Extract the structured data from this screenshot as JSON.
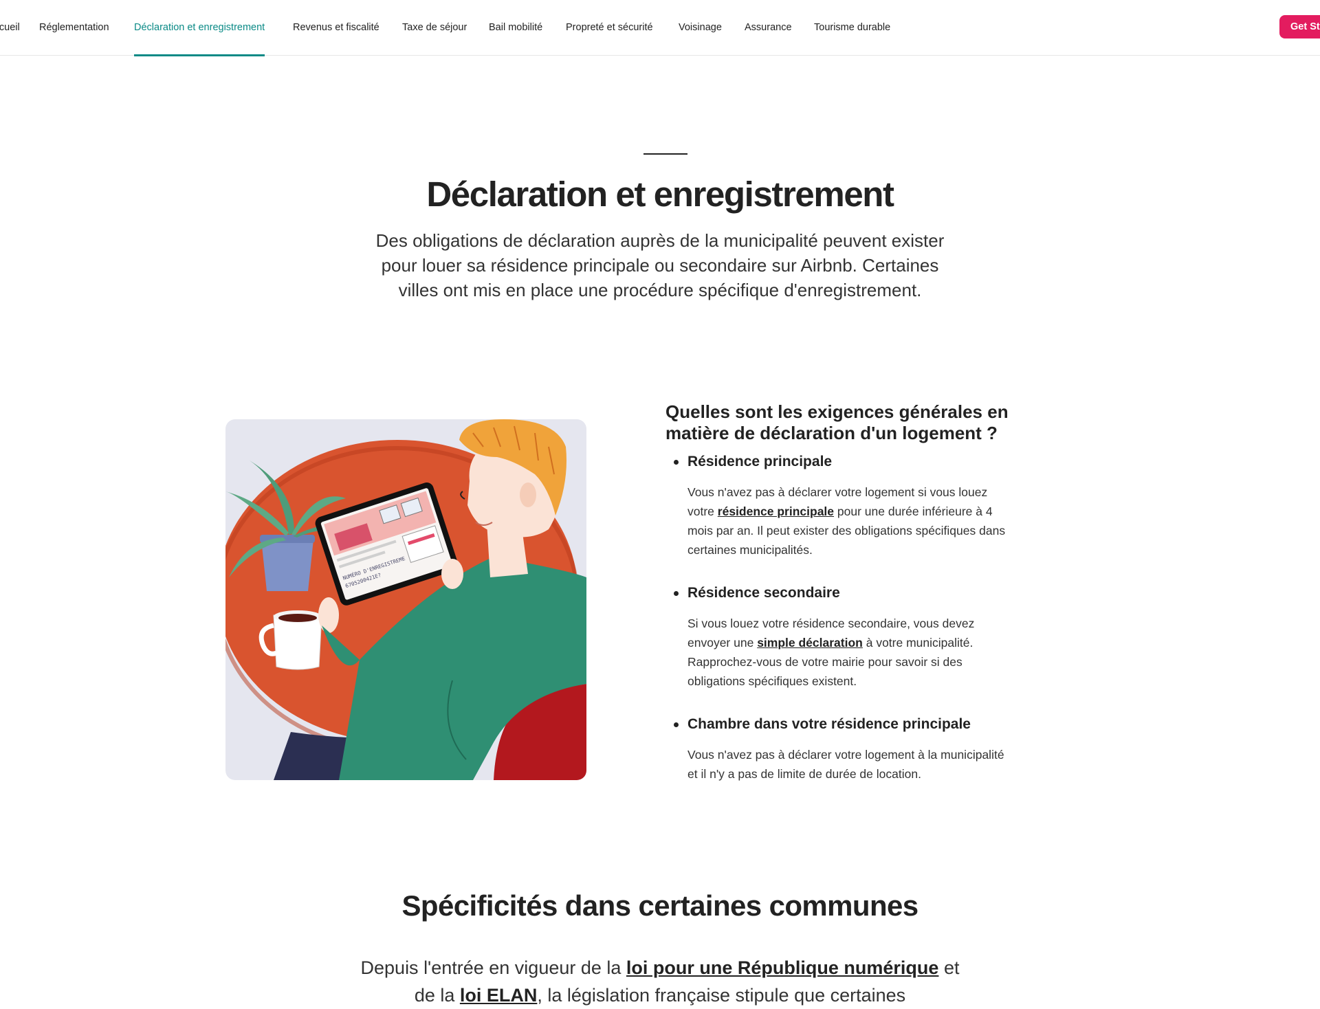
{
  "nav": {
    "items": [
      {
        "label": "Accueil"
      },
      {
        "label": "Réglementation"
      },
      {
        "label": "Déclaration et enregistrement"
      },
      {
        "label": "Revenus et fiscalité"
      },
      {
        "label": "Taxe de séjour"
      },
      {
        "label": "Bail mobilité"
      },
      {
        "label": "Propreté et sécurité"
      },
      {
        "label": "Voisinage"
      },
      {
        "label": "Assurance"
      },
      {
        "label": "Tourisme durable"
      }
    ],
    "active_index": 2,
    "cta_label": "Get Started"
  },
  "hero": {
    "title": "Déclaration et enregistrement",
    "lines": [
      "Des obligations de déclaration auprès de la municipalité peuvent exister",
      "pour louer sa résidence principale ou secondaire sur Airbnb. Certaines",
      "villes ont mis en place une procédure spécifique d'enregistrement."
    ]
  },
  "illustration": {
    "screen_lines": [
      "NUMÉRO D'ENREGISTREME",
      "6705200421E?"
    ]
  },
  "requirements": {
    "heading_lines": [
      "Quelles sont les exigences générales en",
      "matière de déclaration d'un logement ?"
    ],
    "items": [
      {
        "title": "Résidence principale",
        "line1": "Vous n'avez pas à déclarer votre logement si vous louez",
        "line2_prefix": "votre ",
        "line2_link": "résidence principale",
        "line2_suffix": " pour une durée inférieure à 4",
        "line3": "mois par an. Il peut exister des obligations spécifiques dans",
        "line4": "certaines municipalités."
      },
      {
        "title": "Résidence secondaire",
        "line1": "Si vous louez votre résidence secondaire, vous devez",
        "line2_prefix": "envoyer une ",
        "line2_link": "simple déclaration",
        "line2_suffix": " à votre municipalité.",
        "line3": "Rapprochez-vous de votre mairie pour savoir si des",
        "line4": "obligations spécifiques existent."
      },
      {
        "title": "Chambre dans votre résidence principale",
        "line1": "Vous n'avez pas à déclarer votre logement à la municipalité",
        "line2": "et il n'y a pas de limite de durée de location."
      }
    ]
  },
  "communes": {
    "title": "Spécificités dans certaines communes",
    "text_prefix": "Depuis l'entrée en vigueur de la ",
    "link1": "loi pour une République numérique",
    "text_mid": " et",
    "line2_prefix": "de la ",
    "link2": "loi ELAN",
    "line2_suffix": ", la législation française stipule que certaines"
  },
  "colors": {
    "accent": "#0a8a86",
    "cta": "#e31c5f",
    "text": "#222222"
  }
}
